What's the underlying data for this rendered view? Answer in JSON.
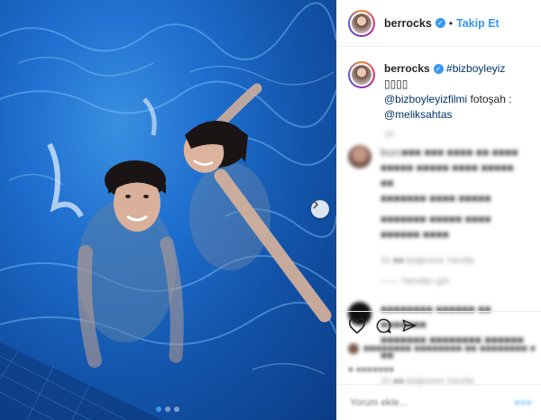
{
  "header": {
    "username": "berrocks",
    "separator": "•",
    "follow_label": "Takip Et"
  },
  "caption": {
    "username": "berrocks",
    "hashtag": "#bizboyleyiz",
    "emoji": "▯▯▯▯",
    "mention1": "@bizboyleyizfilmi",
    "middle": " fotoşah : ",
    "mention2": "@meliksahtas"
  },
  "comments": [
    {
      "time_marker": "1h",
      "lines": [
        "burc■■■ ■■■ ■■■■ ■■ ■■■■",
        "■■■■■ ■■■■■ ■■■■ ■■■■■ ■■",
        "■■■■■■■ ■■■■ ■■■■■",
        "■■■■■■■ ■■■■■ ■■■■",
        "■■■■■■ ■■■■"
      ],
      "meta": "1h   ■■ beğenme   Yanıtla",
      "replies": "—— Yanıtları gör"
    },
    {
      "lines": [
        "■■■■■■■■ ■■■■■■ ■■ ■■■■■■■",
        "■■■■■■■ ■■■■■■■■ ■■■■■■ ■■"
      ],
      "meta": "1h   ■■ beğenme   Yanıtla"
    }
  ],
  "likes_text": "■■■■■■■■ ■■■■■■■■ ■■ ■■■■■■■■ ■■■■■■ ■■ ■■■■■",
  "timestamp": "■ ■■■■■■■",
  "add_comment_placeholder": "Yorum ekle...",
  "carousel": {
    "slide_count": 3,
    "active_slide": 1
  },
  "colors": {
    "accent": "#3897f0",
    "link": "#003569",
    "water": "#1a5fbf"
  },
  "icons": [
    "verified-badge-icon",
    "chevron-right-icon",
    "heart-icon",
    "comment-icon",
    "share-icon"
  ]
}
